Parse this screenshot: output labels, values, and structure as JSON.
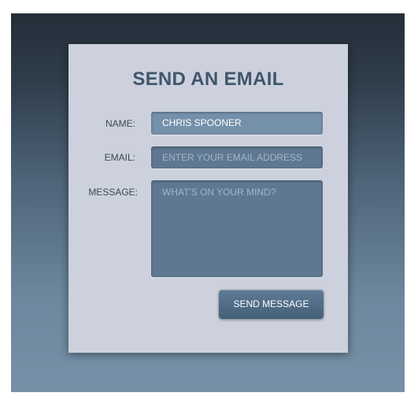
{
  "form": {
    "title": "SEND AN EMAIL",
    "name_label": "NAME:",
    "name_value": "CHRIS SPOONER",
    "email_label": "EMAIL:",
    "email_placeholder": "ENTER YOUR EMAIL ADDRESS",
    "message_label": "MESSAGE:",
    "message_placeholder": "WHAT'S ON YOUR MIND?",
    "submit_label": "SEND MESSAGE"
  }
}
